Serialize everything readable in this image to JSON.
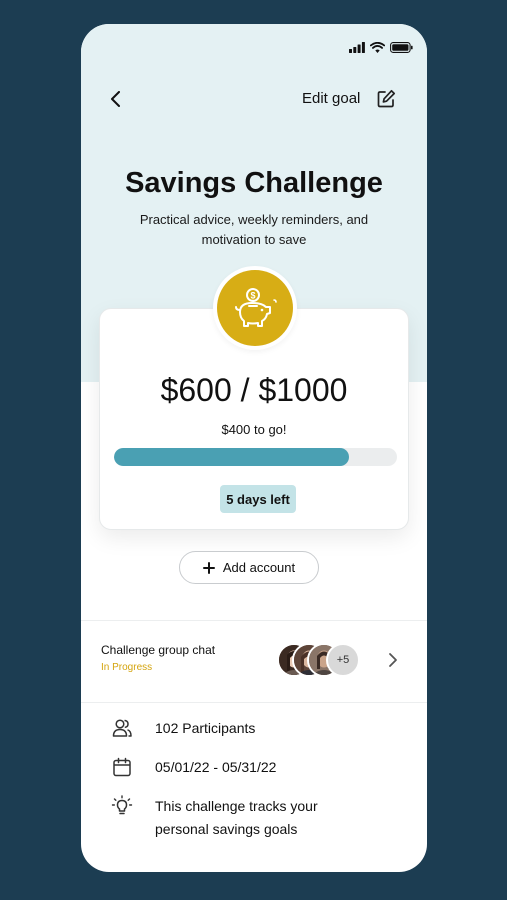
{
  "header": {
    "edit_label": "Edit goal"
  },
  "hero": {
    "title": "Savings Challenge",
    "subtitle": "Practical advice, weekly reminders, and motivation to save"
  },
  "card": {
    "amount": "$600 / $1000",
    "remaining": "$400 to go!",
    "progress": 0.83,
    "days_left": "5 days left"
  },
  "add_account_label": "Add account",
  "chat": {
    "title": "Challenge group chat",
    "status": "In Progress",
    "more_count": "+5"
  },
  "info": {
    "participants": "102 Participants",
    "dates": "05/01/22 - 05/31/22",
    "description": "This challenge tracks your personal savings goals"
  },
  "colors": {
    "background": "#1c3d52",
    "hero": "#e4f1f3",
    "accent_gold": "#d7ad15",
    "progress": "#4aa0b3",
    "badge": "#c3e3e7",
    "status": "#d4a40e"
  },
  "icons": [
    "signal-icon",
    "wifi-icon",
    "battery-icon",
    "back-arrow-icon",
    "edit-icon",
    "piggy-bank-icon",
    "plus-icon",
    "chevron-right-icon",
    "participants-icon",
    "calendar-icon",
    "lightbulb-icon"
  ]
}
